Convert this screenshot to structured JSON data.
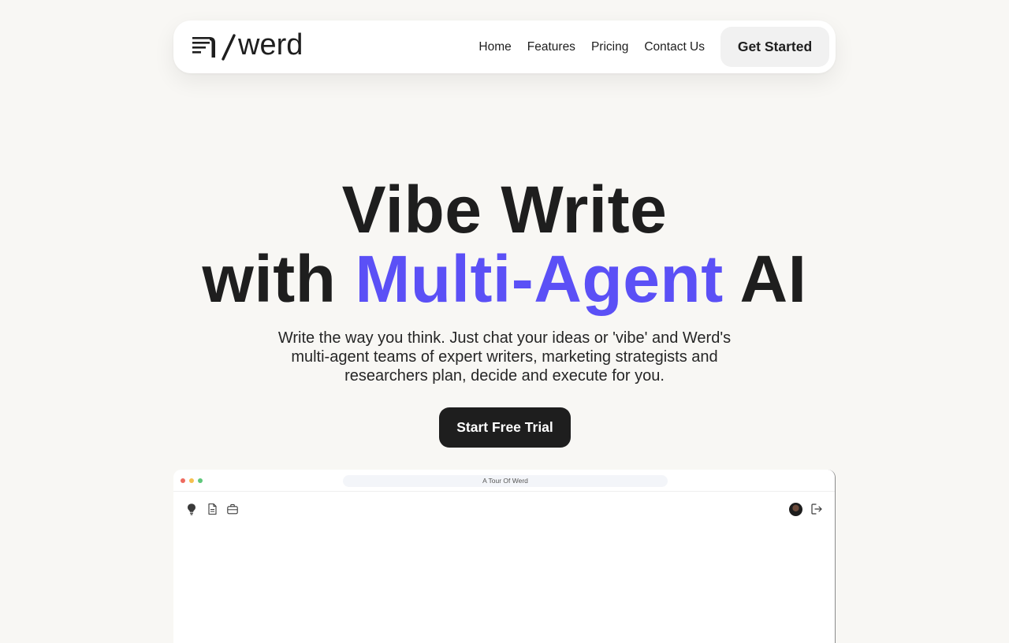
{
  "nav": {
    "logo_text": "/werd",
    "links": [
      "Home",
      "Features",
      "Pricing",
      "Contact Us"
    ],
    "cta_label": "Get Started"
  },
  "hero": {
    "line1": "Vibe Write",
    "line2_prefix": "with ",
    "line2_accent": "Multi-Agent",
    "line2_suffix": " AI",
    "subtitle_lines": [
      "Write the way you think. Just chat your ideas or 'vibe' and Werd's",
      "multi-agent teams of expert writers, marketing strategists and",
      "researchers plan, decide and execute for you."
    ],
    "cta_label": "Start Free Trial"
  },
  "preview": {
    "window_title": "A Tour Of Werd",
    "left_icons": [
      "lightbulb-icon",
      "document-icon",
      "briefcase-icon"
    ],
    "right_icons": [
      "avatar",
      "logout-icon"
    ]
  },
  "colors": {
    "accent": "#5b50f6",
    "background": "#f8f7f4",
    "text": "#1e1e1e",
    "cta_dark": "#1e1e1e"
  }
}
